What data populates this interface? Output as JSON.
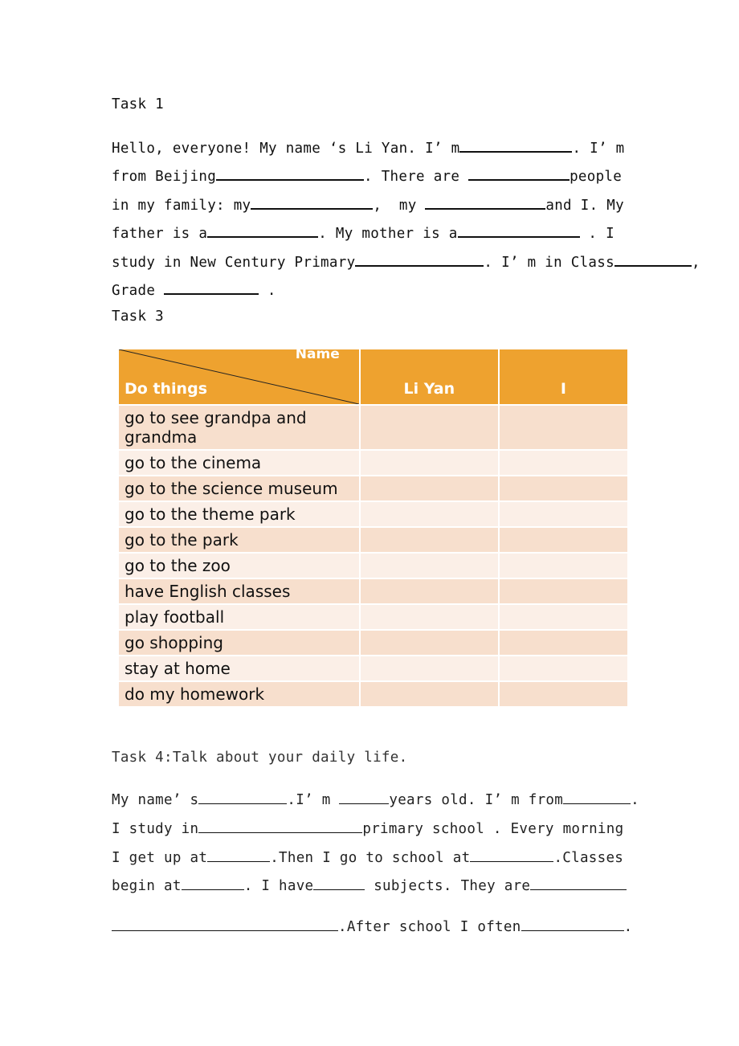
{
  "task1": {
    "title": "Task 1",
    "lines": [
      [
        "Hello, everyone! My name ‘s Li Yan. I’ m",
        ". I’ m"
      ],
      [
        "from Beijing",
        ". There are ",
        "people"
      ],
      [
        "in my family: my",
        ",  my ",
        "and I. My"
      ],
      [
        "father is a",
        ". My mother is a",
        " . I"
      ],
      [
        "study in New Century Primary",
        ". I’ m in Class",
        ","
      ],
      [
        "Grade ",
        " ."
      ]
    ]
  },
  "task3": {
    "title": "Task 3",
    "table": {
      "header_name": "Name",
      "header_do_things": "Do things",
      "columns": [
        "Li Yan",
        "I"
      ],
      "rows": [
        "go to see grandpa and grandma",
        "go to the cinema",
        "go to the science museum",
        "go to the theme park",
        "go to the park",
        "go to the zoo",
        "have English classes",
        "play football",
        "go shopping",
        "stay at home",
        "do my homework"
      ]
    },
    "colors": {
      "header_bg": "#eea22f",
      "row_dark": "#f7dfcd",
      "row_light": "#fbefe7"
    }
  },
  "task4": {
    "title": "Task 4:Talk about your daily life.",
    "lines": [
      [
        "My name’ s",
        ".I’ m ",
        "years old. I’ m from",
        "."
      ],
      [
        "I study in",
        "primary school . Every morning"
      ],
      [
        "I get up at",
        ".Then I go to school at",
        ".Classes"
      ],
      [
        "begin at",
        ". I have",
        " subjects. They are"
      ],
      [
        "",
        ".After school I often",
        "."
      ]
    ]
  }
}
